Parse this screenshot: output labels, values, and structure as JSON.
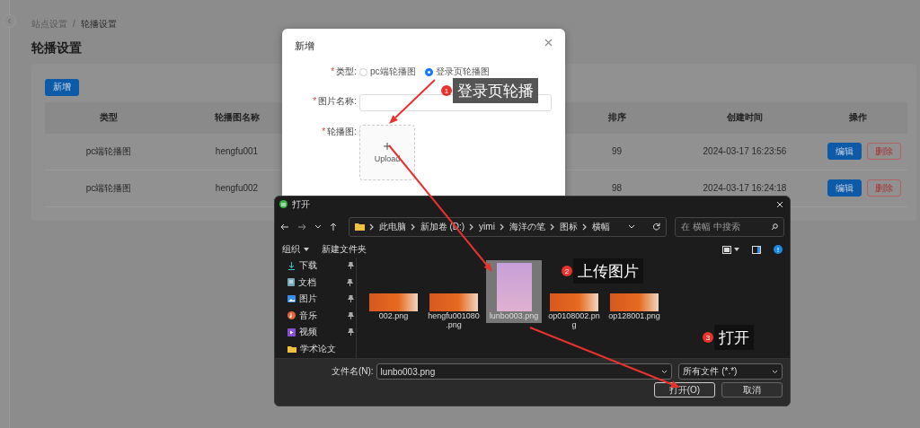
{
  "page": {
    "breadcrumb": [
      "站点设置",
      "轮播设置"
    ],
    "breadcrumb_separator": "/",
    "title": "轮播设置",
    "add_button": "新增"
  },
  "table": {
    "columns": [
      "类型",
      "轮播图名称",
      "排序",
      "创建时间",
      "操作"
    ],
    "rows": [
      {
        "type": "pc端轮播图",
        "name": "hengfu001",
        "sort": "99",
        "created": "2024-03-17 16:23:56",
        "actions": [
          {
            "label": "编辑",
            "kind": "primary"
          },
          {
            "label": "删除",
            "kind": "danger"
          }
        ]
      },
      {
        "type": "pc端轮播图",
        "name": "hengfu002",
        "sort": "98",
        "created": "2024-03-17 16:24:18",
        "actions": [
          {
            "label": "编辑",
            "kind": "primary"
          },
          {
            "label": "删除",
            "kind": "danger"
          }
        ]
      }
    ]
  },
  "modal": {
    "title": "新增",
    "fields": [
      {
        "kind": "radio",
        "marker": "*",
        "label": "类型:",
        "options": [
          {
            "label": "pc端轮播图",
            "selected": false
          },
          {
            "label": "登录页轮播图",
            "selected": true
          }
        ]
      },
      {
        "kind": "input",
        "marker": "*",
        "label": "图片名称:"
      },
      {
        "kind": "upload",
        "marker": "*",
        "label": "轮播图:",
        "upload_label": "Upload"
      }
    ]
  },
  "file_dialog": {
    "title": "打开",
    "path": [
      "此电脑",
      "新加卷 (D:)",
      "yimi",
      "海洋の笔",
      "图标",
      "横幅"
    ],
    "search_placeholder": "在 横幅 中搜索",
    "toolbar": [
      "组织",
      "新建文件夹"
    ],
    "sidebar": [
      {
        "label": "下载",
        "kind": "download",
        "pinned": true
      },
      {
        "label": "文档",
        "kind": "document",
        "pinned": true
      },
      {
        "label": "图片",
        "kind": "picture",
        "pinned": true
      },
      {
        "label": "音乐",
        "kind": "music",
        "pinned": true
      },
      {
        "label": "视频",
        "kind": "video",
        "pinned": true
      },
      {
        "label": "学术论文",
        "kind": "folder",
        "pinned": false
      }
    ],
    "files": [
      {
        "name": "002.png",
        "kind": "banner",
        "selected": false
      },
      {
        "name": "hengfu001080.png",
        "kind": "banner",
        "selected": false
      },
      {
        "name": "lunbo003.png",
        "kind": "portrait",
        "selected": true
      },
      {
        "name": "op0108002.png",
        "kind": "banner",
        "selected": false
      },
      {
        "name": "op128001.png",
        "kind": "banner",
        "selected": false
      }
    ],
    "filename_label": "文件名(N):",
    "filename": "lunbo003.png",
    "filter": "所有文件 (*.*)",
    "buttons": [
      "打开(O)",
      "取消"
    ]
  },
  "callouts": [
    {
      "number": "1",
      "text": "登录页轮播"
    },
    {
      "number": "2",
      "text": "上传图片"
    },
    {
      "number": "3",
      "text": "打开"
    }
  ]
}
